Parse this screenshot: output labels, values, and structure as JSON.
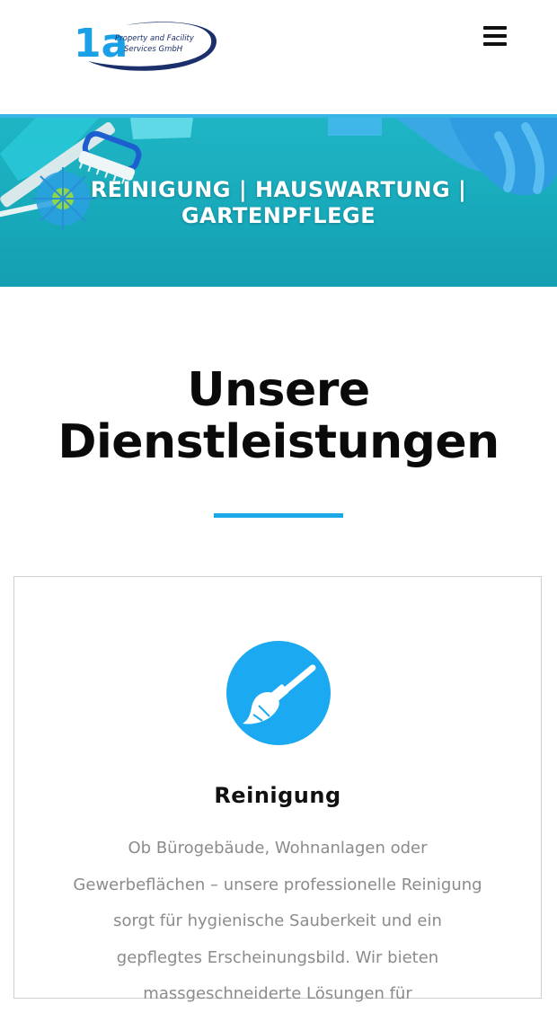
{
  "header": {
    "logo": {
      "mark": "1a",
      "line1": "Property and Facility",
      "line2": "Services GmbH",
      "icon": "company-logo"
    },
    "menu_icon": "hamburger-menu-icon"
  },
  "hero": {
    "title": "REINIGUNG | HAUSWARTUNG |\nGARTENPFLEGE"
  },
  "services": {
    "title": "Unsere\nDienstleistungen",
    "accent_color": "#1aa9e6",
    "cards": [
      {
        "icon": "brush-icon",
        "title": "Reinigung",
        "text": "Ob Bürogebäude, Wohnanlagen oder Gewerbeflächen – unsere professionelle Reinigung sorgt für hygienische Sauberkeit und ein gepflegtes Erscheinungsbild. Wir bieten massgeschneiderte Lösungen für"
      }
    ]
  }
}
